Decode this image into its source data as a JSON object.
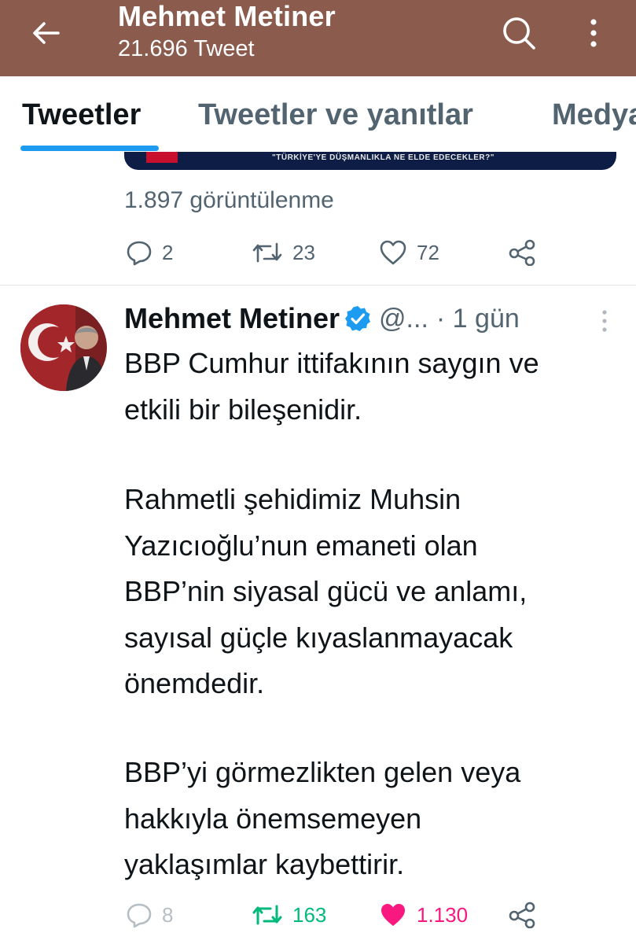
{
  "header": {
    "title": "Mehmet Metiner",
    "subtitle": "21.696 Tweet",
    "icons": {
      "back": "arrow-left-icon",
      "search": "search-icon",
      "more": "more-vertical-icon"
    },
    "bg_color": "#8b5c4e"
  },
  "tabs": [
    {
      "label": "Tweetler",
      "active": true
    },
    {
      "label": "Tweetler ve yanıtlar",
      "active": false
    },
    {
      "label": "Medya",
      "active": false
    }
  ],
  "previous_tweet": {
    "media_caption": "\"TÜRKİYE'YE DÜŞMANLIKLA NE ELDE EDECEKLER?\"",
    "views": "1.897 görüntülenme",
    "actions": {
      "replies": "2",
      "retweets": "23",
      "likes": "72"
    }
  },
  "tweet": {
    "author": "Mehmet Metiner",
    "handle": "@...",
    "time": "· 1 gün",
    "paragraphs": [
      [
        "BBP Cumhur ittifakının saygın ve",
        "etkili bir bileşenidir."
      ],
      [
        "Rahmetli şehidimiz Muhsin",
        "Yazıcıoğlu’nun emaneti olan",
        "BBP’nin siyasal gücü ve anlamı,",
        "sayısal güçle kıyaslanmayacak",
        "önemdedir."
      ],
      [
        "BBP’yi görmezlikten gelen veya",
        "hakkıyla önemsemeyen",
        "yaklaşımlar kaybettirir."
      ]
    ],
    "actions": {
      "replies": "8",
      "retweets": "163",
      "likes": "1.130"
    },
    "retweeted": true,
    "liked": true
  },
  "colors": {
    "accent": "#1d9bf0",
    "retweet": "#00ba7c",
    "like": "#f91880",
    "muted": "#536471"
  }
}
